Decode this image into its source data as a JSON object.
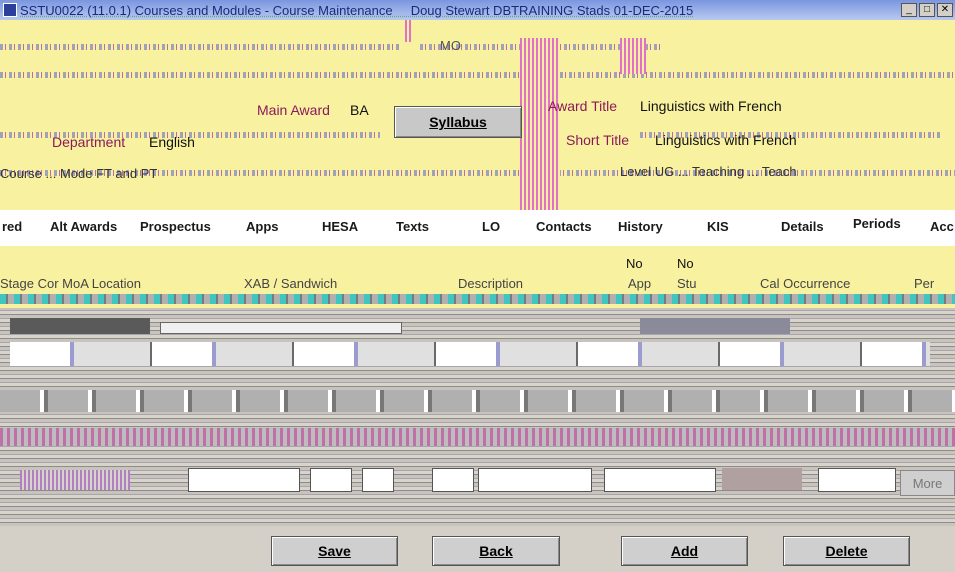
{
  "window": {
    "title": "SSTU0022 (11.0.1) Courses and Modules - Course Maintenance",
    "title_tail": "Doug Stewart  DBTRAINING  Stads 01-DEC-2015",
    "minimize": "_",
    "restore": "□",
    "close": "✕"
  },
  "course": {
    "code_partial": "MO",
    "main_award_label": "Main Award",
    "main_award_value": "BA",
    "award_title_label": "Award Title",
    "award_title_value": "Linguistics with French",
    "department_label": "Department",
    "department_value": "English",
    "short_title_label": "Short Title",
    "short_title_value": "Linguistics with French",
    "syllabus_button": "Syllabus",
    "course_mode_partial": "Course ... Mode  FT and PT",
    "right_partial": "Level  UG  ...  Teaching ... Teach"
  },
  "tabs": [
    "red",
    "Alt Awards",
    "Prospectus",
    "Apps",
    "HESA",
    "Texts",
    "LO",
    "Contacts",
    "History",
    "KIS",
    "Details",
    "Periods",
    "Acc"
  ],
  "active_tab": "Periods",
  "periods": {
    "no_1": "No",
    "no_2": "No",
    "header_partial": "Stage Cor MoA  Location",
    "col_xab": "XAB / Sandwich",
    "col_description": "Description",
    "col_app": "App",
    "col_stu": "Stu",
    "col_cal": "Cal Occurrence",
    "col_per": "Per",
    "more_button": "More"
  },
  "footer": {
    "save": "Save",
    "back": "Back",
    "add": "Add",
    "delete": "Delete"
  },
  "colors": {
    "panel_bg": "#f8f2a0",
    "label_color": "#8b1a5a",
    "footer_bg": "#d4d0c8"
  }
}
